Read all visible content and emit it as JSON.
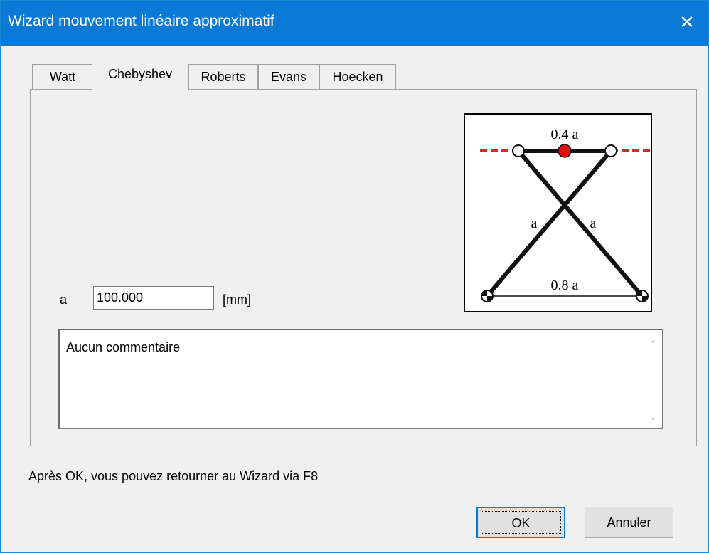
{
  "window": {
    "title": "Wizard mouvement linéaire approximatif",
    "close_glyph": "✕"
  },
  "tabs": [
    {
      "label": "Watt"
    },
    {
      "label": "Chebyshev",
      "active": true
    },
    {
      "label": "Roberts"
    },
    {
      "label": "Evans"
    },
    {
      "label": "Hoecken"
    }
  ],
  "param": {
    "label": "a",
    "value": "100.000",
    "unit": "[mm]"
  },
  "comment": {
    "text": "Aucun commentaire",
    "scroll_up": "⌃",
    "scroll_down": "⌄"
  },
  "diagram": {
    "top_label": "0.4 a",
    "left_label": "a",
    "right_label": "a",
    "bottom_label": "0.8 a",
    "trace_color": "#d42a2a",
    "point_color": "#e01010"
  },
  "info": {
    "text": "Après OK, vous pouvez retourner au Wizard via F8"
  },
  "buttons": {
    "ok": "OK",
    "cancel": "Annuler"
  }
}
